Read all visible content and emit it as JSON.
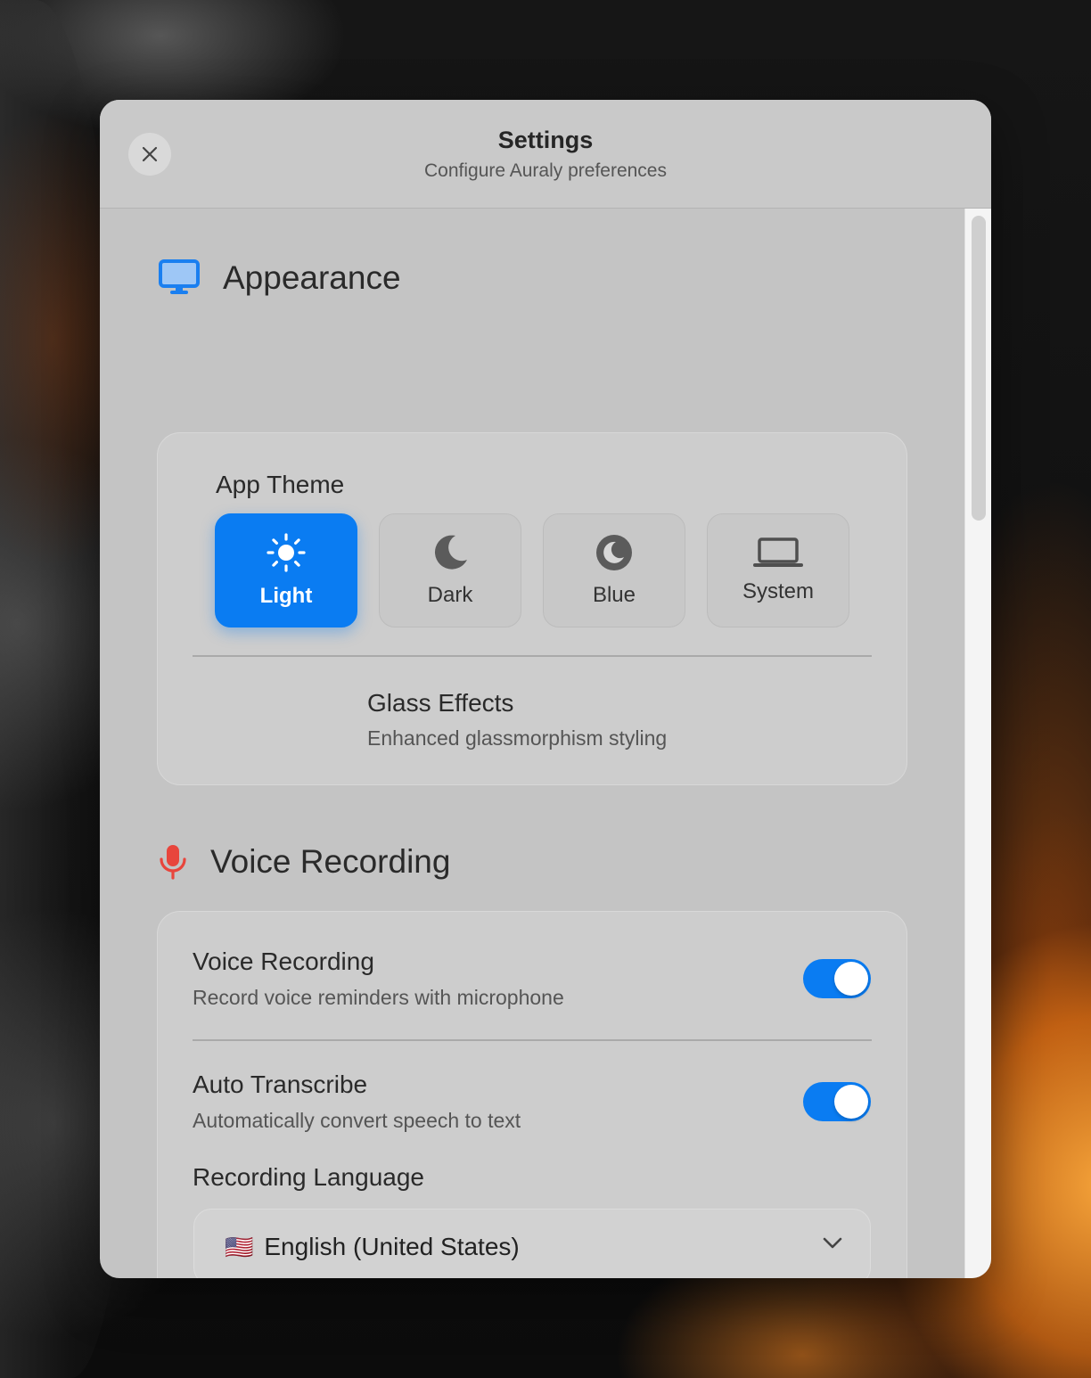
{
  "header": {
    "title": "Settings",
    "subtitle": "Configure Auraly preferences"
  },
  "appearance": {
    "section_title": "Appearance",
    "theme_label": "App Theme",
    "themes": [
      {
        "label": "Light",
        "icon": "sun-icon",
        "selected": true
      },
      {
        "label": "Dark",
        "icon": "moon-icon",
        "selected": false
      },
      {
        "label": "Blue",
        "icon": "moon-circle-icon",
        "selected": false
      },
      {
        "label": "System",
        "icon": "laptop-icon",
        "selected": false
      }
    ],
    "glass_effects": {
      "title": "Glass Effects",
      "description": "Enhanced glassmorphism styling"
    }
  },
  "voice": {
    "section_title": "Voice Recording",
    "recording": {
      "title": "Voice Recording",
      "description": "Record voice reminders with microphone",
      "enabled": true
    },
    "transcribe": {
      "title": "Auto Transcribe",
      "description": "Automatically convert speech to text",
      "enabled": true
    },
    "language": {
      "label": "Recording Language",
      "flag": "🇺🇸",
      "value": "English (United States)"
    }
  },
  "colors": {
    "accent": "#0a7cf2",
    "appearance_icon": "#1a7ff0",
    "voice_icon": "#e8453c"
  }
}
